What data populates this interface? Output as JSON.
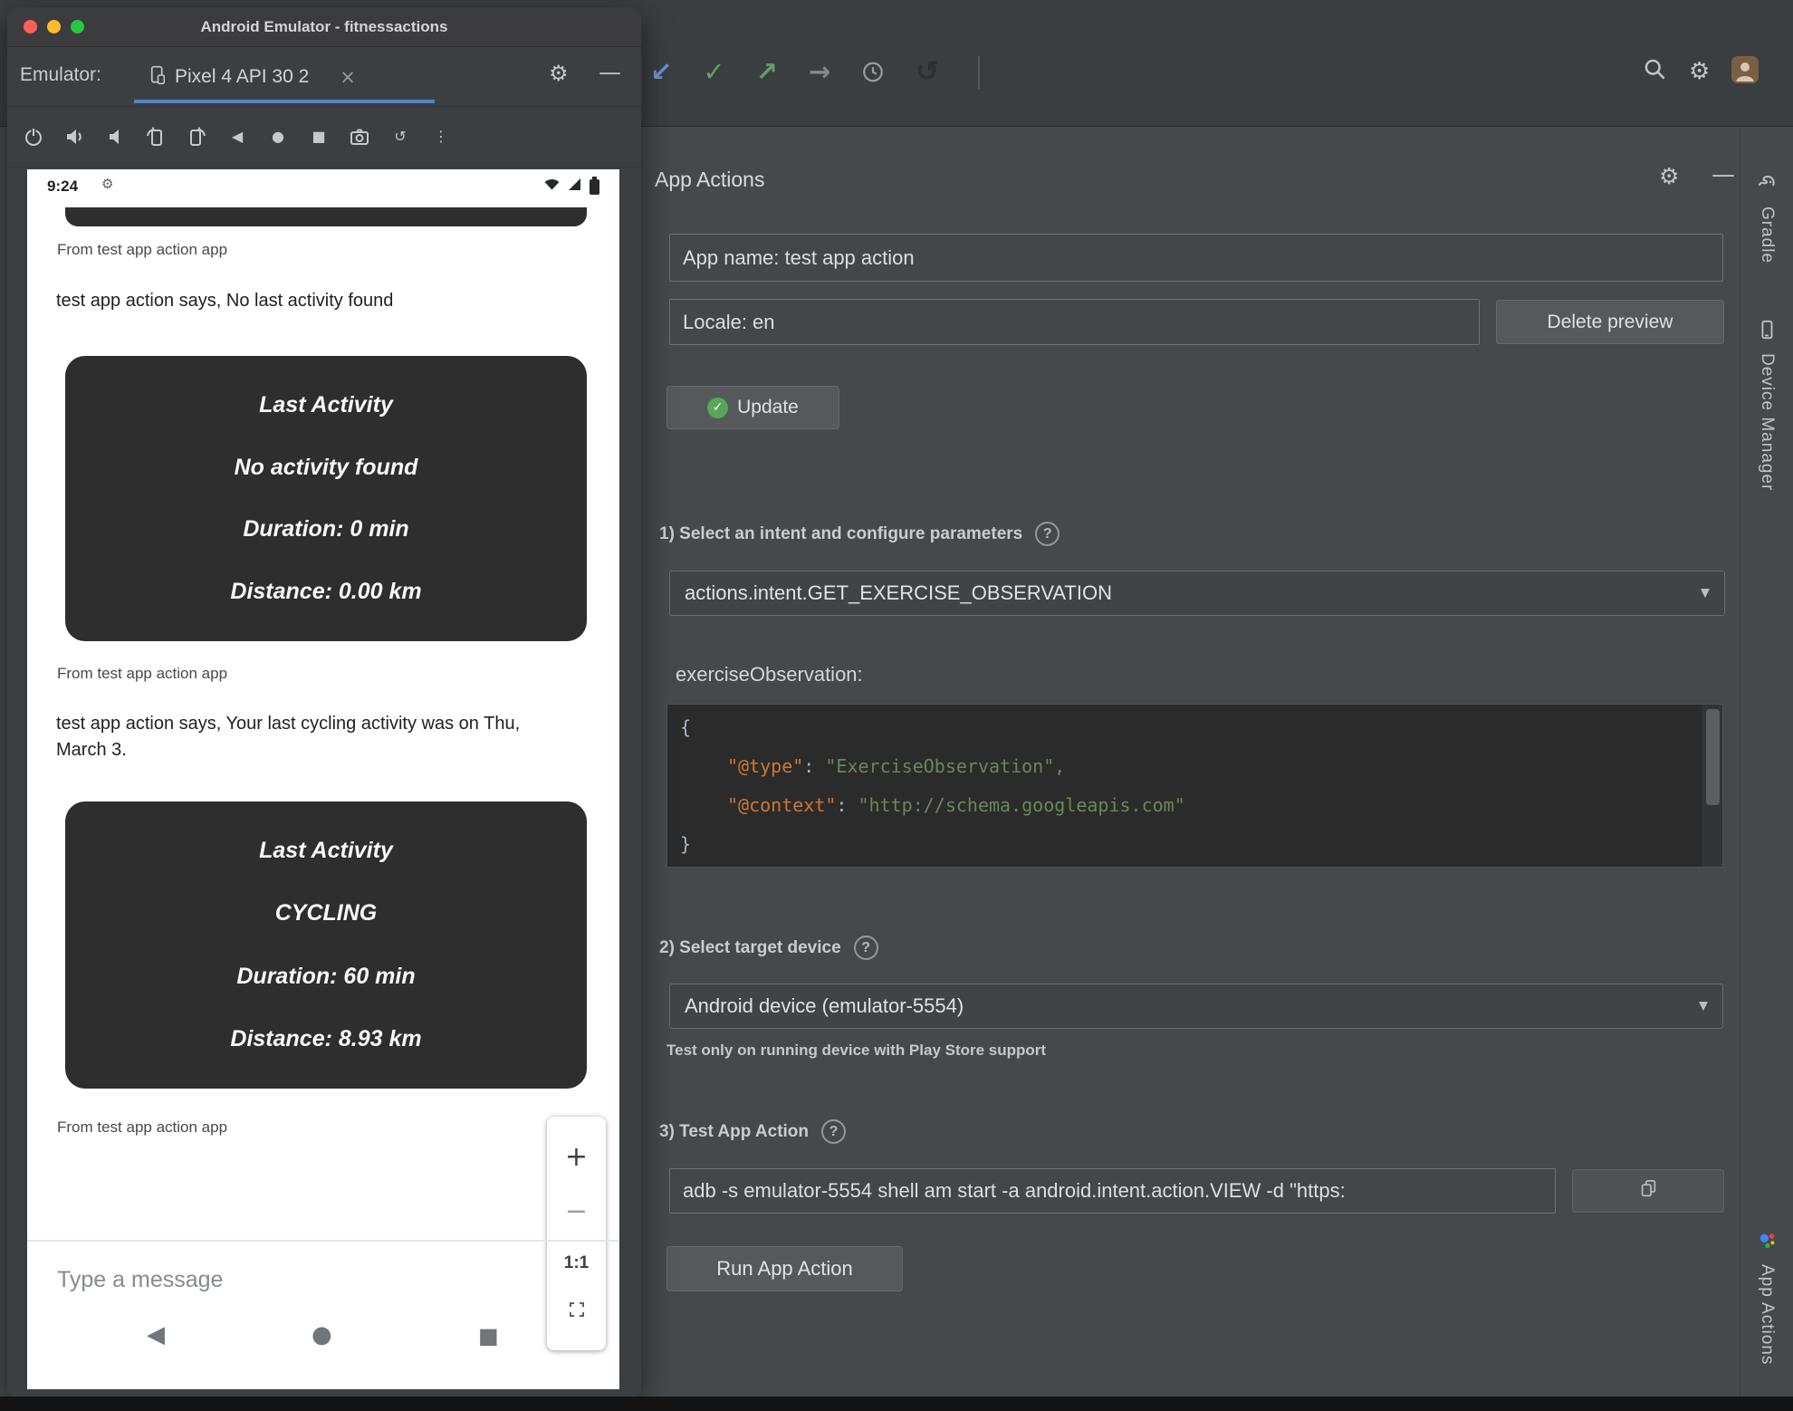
{
  "colors": {
    "accent_blue": "#4b87c5",
    "traffic_red": "#ff5f57",
    "traffic_yellow": "#febc2e",
    "traffic_green": "#28c840",
    "success_green": "#57a65a",
    "code_key_orange": "#cb7832",
    "code_string_green": "#6a8759"
  },
  "icons": {
    "close": "×",
    "gear": "⚙",
    "minimize": "—",
    "more_vertical": "⋮",
    "back": "◀",
    "home": "●",
    "overview": "■",
    "undo": "↺",
    "rotate": "↺",
    "arrow_down_left": "↙",
    "check": "✓",
    "arrow_up_right": "↗",
    "arrow_right": "→",
    "plus": "+",
    "minus": "−",
    "dropdown_arrow": "▼",
    "question": "?"
  },
  "emulator": {
    "window_title": "Android Emulator - fitnessactions",
    "toolbar": {
      "label": "Emulator:",
      "tab": "Pixel 4 API 30 2"
    },
    "phone": {
      "status_time": "9:24",
      "sender": "From test app action app",
      "message1": "test app action says, No last activity found",
      "message2": "test app action says, Your last cycling activity was on Thu, March 3.",
      "cards": [
        {
          "title": "Last Activity",
          "activity": "No activity found",
          "duration": "Duration: 0 min",
          "distance": "Distance: 0.00 km"
        },
        {
          "title": "Last Activity",
          "activity": "CYCLING",
          "duration": "Duration: 60 min",
          "distance": "Distance: 8.93 km"
        }
      ],
      "zoom_ratio": "1:1",
      "input_placeholder": "Type a message"
    }
  },
  "ide": {
    "panel_title": "App Actions",
    "app_name_field": "App name: test app action",
    "locale_field": "Locale: en",
    "delete_preview_button": "Delete preview",
    "update_button": "Update",
    "sections": {
      "intent": "1) Select an intent and configure parameters",
      "device": "2) Select target device",
      "test": "3) Test App Action"
    },
    "intent_dropdown": "actions.intent.GET_EXERCISE_OBSERVATION",
    "param_label": "exerciseObservation:",
    "code": {
      "open": "{",
      "key1": "\"@type\"",
      "colon": ": ",
      "value1": "\"ExerciseObservation\",",
      "key2": "\"@context\"",
      "value2": "\"http://schema.googleapis.com\"",
      "close": "}"
    },
    "device_dropdown": "Android device (emulator-5554)",
    "device_hint": "Test only on running device with Play Store support",
    "adb_command": "adb -s emulator-5554 shell am start -a android.intent.action.VIEW -d \"https:",
    "run_button": "Run App Action",
    "sidebar": {
      "gradle": "Gradle",
      "device_manager": "Device Manager",
      "app_actions": "App Actions"
    }
  }
}
